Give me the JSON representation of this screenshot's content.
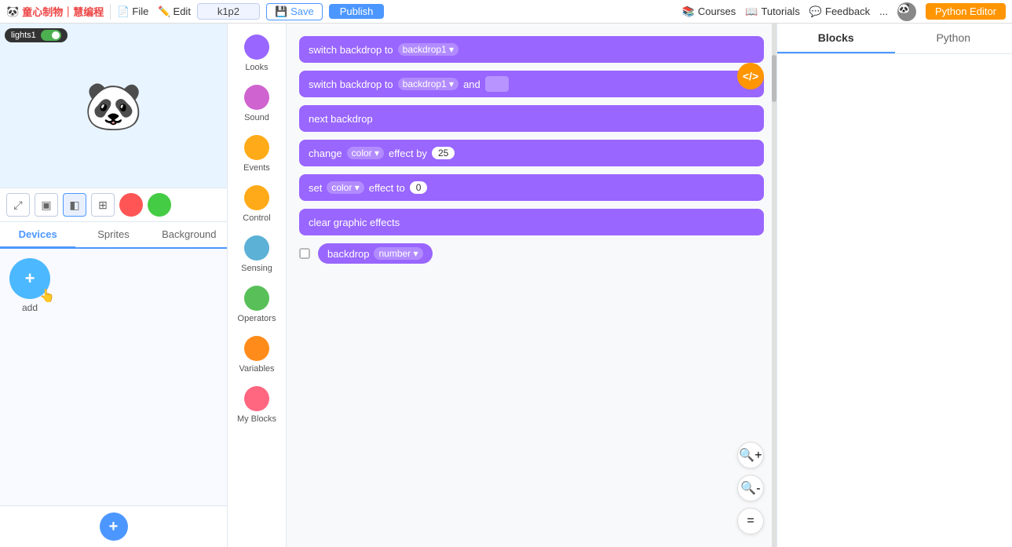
{
  "topbar": {
    "logo": "童心制物｜慧编程",
    "menu": {
      "file": "File",
      "edit": "Edit"
    },
    "project_name": "k1p2",
    "save_label": "Save",
    "publish_label": "Publish",
    "right": {
      "courses": "Courses",
      "tutorials": "Tutorials",
      "feedback": "Feedback",
      "more": "...",
      "python_editor": "Python Editor"
    }
  },
  "left_panel": {
    "stage": {
      "lights_label": "lights1",
      "toggle_state": "on"
    },
    "tabs": {
      "devices": "Devices",
      "sprites": "Sprites",
      "background": "Background"
    },
    "add_label": "add"
  },
  "blocks_panel": {
    "categories": [
      {
        "id": "looks",
        "label": "Looks",
        "color": "#9966ff"
      },
      {
        "id": "sound",
        "label": "Sound",
        "color": "#cf63cf"
      },
      {
        "id": "events",
        "label": "Events",
        "color": "#ffab19"
      },
      {
        "id": "control",
        "label": "Control",
        "color": "#ffab19"
      },
      {
        "id": "sensing",
        "label": "Sensing",
        "color": "#5cb1d6"
      },
      {
        "id": "operators",
        "label": "Operators",
        "color": "#59c059"
      },
      {
        "id": "variables",
        "label": "Variables",
        "color": "#ff8c1a"
      },
      {
        "id": "my_blocks",
        "label": "My Blocks",
        "color": "#ff6680"
      }
    ]
  },
  "code_blocks": [
    {
      "id": "switch_backdrop1",
      "type": "purple",
      "text_before": "switch backdrop to",
      "dropdown": "backdrop1",
      "text_after": ""
    },
    {
      "id": "switch_backdrop2",
      "type": "purple",
      "text_before": "switch backdrop to",
      "dropdown": "backdrop1",
      "text_after": "and"
    },
    {
      "id": "next_backdrop",
      "type": "purple",
      "text": "next backdrop"
    },
    {
      "id": "change_color_effect",
      "type": "purple",
      "text_before": "change",
      "dropdown1": "color",
      "text_middle": "effect by",
      "value": "25"
    },
    {
      "id": "set_color_effect",
      "type": "purple",
      "text_before": "set",
      "dropdown1": "color",
      "text_middle": "effect to",
      "value": "0"
    },
    {
      "id": "clear_graphic_effects",
      "type": "purple",
      "text": "clear graphic effects"
    },
    {
      "id": "backdrop_number",
      "type": "reporter",
      "has_checkbox": true,
      "text_before": "backdrop",
      "dropdown": "number"
    }
  ],
  "right_panel": {
    "tabs": {
      "blocks": "Blocks",
      "python": "Python"
    },
    "active_tab": "Blocks"
  },
  "zoom_controls": {
    "zoom_in": "+",
    "zoom_out": "-",
    "zoom_fit": "="
  }
}
